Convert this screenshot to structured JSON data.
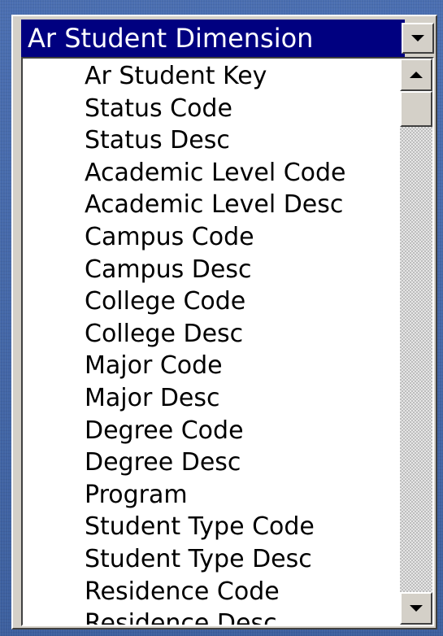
{
  "dropdown": {
    "selected": "Ar Student Dimension"
  },
  "list": {
    "items": [
      {
        "label": "Ar Student Key"
      },
      {
        "label": "Status Code"
      },
      {
        "label": "Status Desc"
      },
      {
        "label": "Academic Level Code"
      },
      {
        "label": "Academic Level Desc"
      },
      {
        "label": "Campus Code"
      },
      {
        "label": "Campus Desc"
      },
      {
        "label": "College Code"
      },
      {
        "label": "College Desc"
      },
      {
        "label": "Major Code"
      },
      {
        "label": "Major Desc"
      },
      {
        "label": "Degree Code"
      },
      {
        "label": "Degree Desc"
      },
      {
        "label": "Program"
      },
      {
        "label": "Student Type Code"
      },
      {
        "label": "Student Type Desc"
      },
      {
        "label": "Residence Code"
      },
      {
        "label": "Residence Desc"
      }
    ]
  },
  "icons": {
    "dropdown": "chevron-down-icon",
    "scroll_up": "scroll-up-arrow-icon",
    "scroll_down": "scroll-down-arrow-icon"
  },
  "colors": {
    "selection_highlight": "#000080",
    "background": "#3f63a3",
    "panel": "#d4d0c8"
  }
}
